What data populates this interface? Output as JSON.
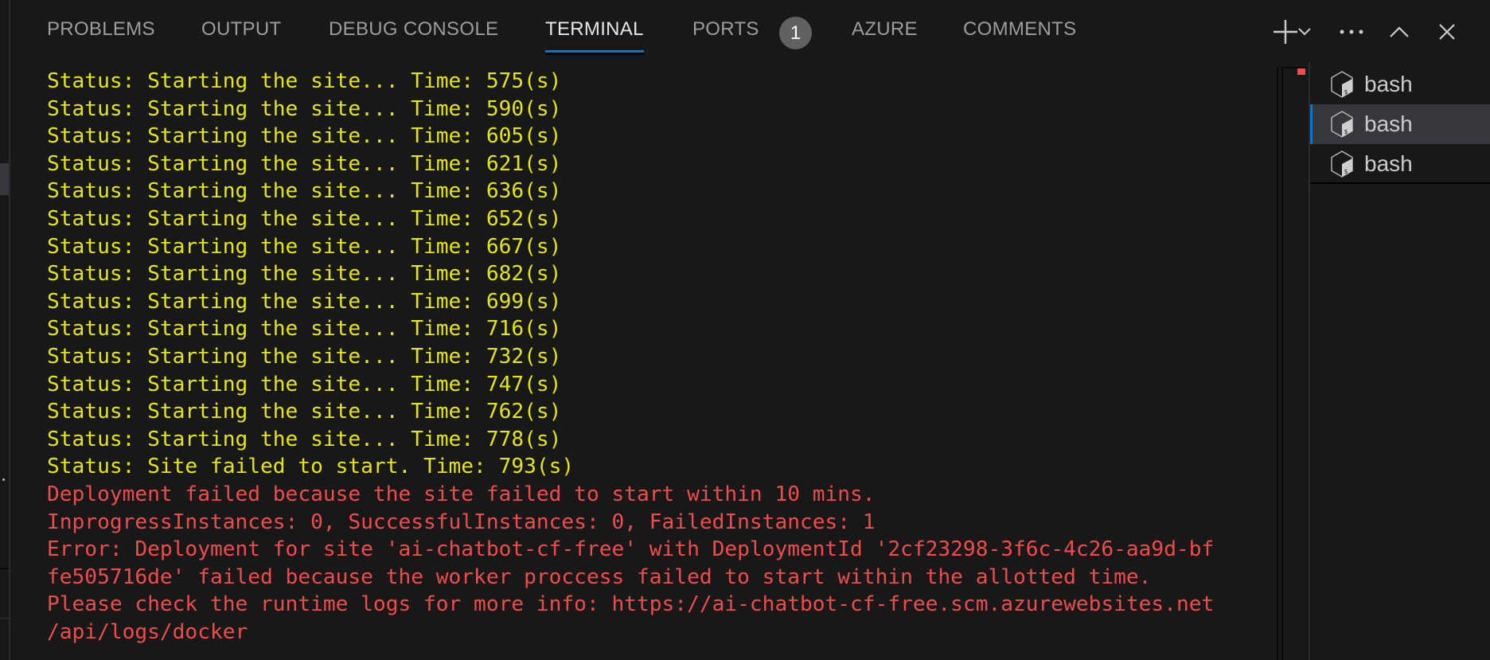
{
  "panel": {
    "tabs": [
      {
        "label": "PROBLEMS",
        "active": false
      },
      {
        "label": "OUTPUT",
        "active": false
      },
      {
        "label": "DEBUG CONSOLE",
        "active": false
      },
      {
        "label": "TERMINAL",
        "active": true
      },
      {
        "label": "PORTS",
        "active": false,
        "badge": "1"
      },
      {
        "label": "AZURE",
        "active": false
      },
      {
        "label": "COMMENTS",
        "active": false
      }
    ],
    "actions": [
      {
        "name": "new-terminal",
        "icon": "plus-icon"
      },
      {
        "name": "launch-profile",
        "icon": "chevron-down-icon"
      },
      {
        "name": "more-actions",
        "icon": "ellipsis-icon"
      },
      {
        "name": "maximize-panel",
        "icon": "chevron-up-icon"
      },
      {
        "name": "close-panel",
        "icon": "close-icon"
      }
    ]
  },
  "terminal": {
    "colors": {
      "status": "#e5e510",
      "error": "#f14c4c"
    },
    "lines": [
      {
        "text": "Status: Starting the site... Time: 575(s)",
        "kind": "status"
      },
      {
        "text": "Status: Starting the site... Time: 590(s)",
        "kind": "status"
      },
      {
        "text": "Status: Starting the site... Time: 605(s)",
        "kind": "status"
      },
      {
        "text": "Status: Starting the site... Time: 621(s)",
        "kind": "status"
      },
      {
        "text": "Status: Starting the site... Time: 636(s)",
        "kind": "status"
      },
      {
        "text": "Status: Starting the site... Time: 652(s)",
        "kind": "status"
      },
      {
        "text": "Status: Starting the site... Time: 667(s)",
        "kind": "status"
      },
      {
        "text": "Status: Starting the site... Time: 682(s)",
        "kind": "status"
      },
      {
        "text": "Status: Starting the site... Time: 699(s)",
        "kind": "status"
      },
      {
        "text": "Status: Starting the site... Time: 716(s)",
        "kind": "status"
      },
      {
        "text": "Status: Starting the site... Time: 732(s)",
        "kind": "status"
      },
      {
        "text": "Status: Starting the site... Time: 747(s)",
        "kind": "status"
      },
      {
        "text": "Status: Starting the site... Time: 762(s)",
        "kind": "status"
      },
      {
        "text": "Status: Starting the site... Time: 778(s)",
        "kind": "status"
      },
      {
        "text": "Status: Site failed to start. Time: 793(s)",
        "kind": "status"
      },
      {
        "text": "Deployment failed because the site failed to start within 10 mins.",
        "kind": "error"
      },
      {
        "text": "InprogressInstances: 0, SuccessfulInstances: 0, FailedInstances: 1",
        "kind": "error"
      },
      {
        "text": "Error: Deployment for site 'ai-chatbot-cf-free' with DeploymentId '2cf23298-3f6c-4c26-aa9d-bf",
        "kind": "error"
      },
      {
        "text": "fe505716de' failed because the worker proccess failed to start within the allotted time.",
        "kind": "error"
      },
      {
        "text": "Please check the runtime logs for more info: https://ai-chatbot-cf-free.scm.azurewebsites.net",
        "kind": "error"
      },
      {
        "text": "/api/logs/docker",
        "kind": "error"
      }
    ]
  },
  "terminal_list": {
    "items": [
      {
        "label": "bash",
        "icon": "bash-icon",
        "active": false
      },
      {
        "label": "bash",
        "icon": "bash-icon",
        "active": true
      },
      {
        "label": "bash",
        "icon": "bash-icon",
        "active": false
      }
    ]
  }
}
